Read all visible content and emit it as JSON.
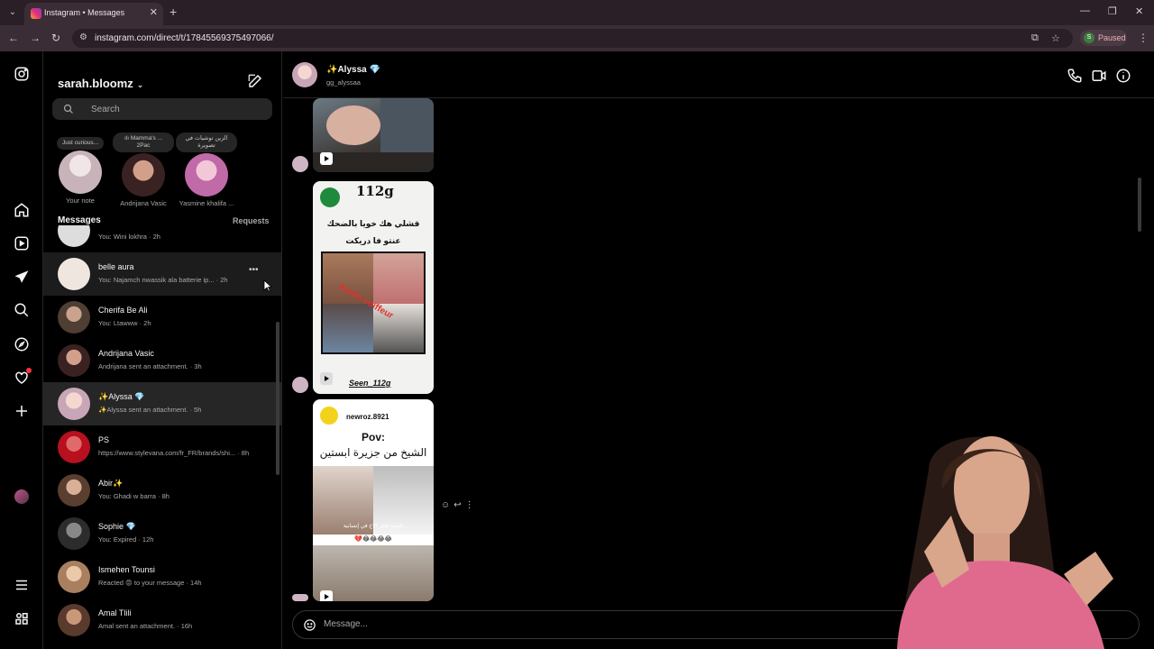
{
  "browser": {
    "tab_title": "Instagram • Messages",
    "url": "instagram.com/direct/t/17845569375497066/",
    "profile_badge": "S",
    "profile_status": "Paused"
  },
  "rail": {
    "icons": [
      "instagram-icon",
      "home-icon",
      "reels-icon",
      "messages-icon",
      "search-icon",
      "explore-icon",
      "heart-icon",
      "create-icon",
      "profile-avatar",
      "menu-icon",
      "apps-icon"
    ]
  },
  "inbox": {
    "username": "sarah.bloomz",
    "search_placeholder": "Search",
    "notes": [
      {
        "bubble": "Just curious...",
        "name": "Your note",
        "color": "#d9c2c8"
      },
      {
        "bubble": "ılı Mamma's ... 2Pac",
        "name": "Andrijana Vasic",
        "color": "#5a3a3a"
      },
      {
        "bubble": "الزين توشيات في تصويرة",
        "name": "Yasmine khalifa ...",
        "color": "#d27fb5"
      }
    ],
    "section_title": "Messages",
    "requests_label": "Requests",
    "conversations": [
      {
        "name": "",
        "sub": "You: Wini lokhra · 2h",
        "color": "#ddd"
      },
      {
        "name": "belle aura",
        "sub": "You: Najamch nwassik ala batterie ip... · 2h",
        "color": "#efe6e0"
      },
      {
        "name": "Cherifa Be Ali",
        "sub": "You: Ltawww · 2h",
        "color": "#6a5a50"
      },
      {
        "name": "Andrijana Vasic",
        "sub": "Andrijana sent an attachment. · 3h",
        "color": "#4b3432"
      },
      {
        "name": "✨Alyssa 💎",
        "sub": "✨Alyssa sent an attachment. · 5h",
        "color": "#c8a6b8"
      },
      {
        "name": "PS",
        "sub": "https://www.stylevana.com/fr_FR/brands/shi... · 8h",
        "color": "#c21d2b"
      },
      {
        "name": "Abir✨",
        "sub": "You: Ghadi w barra · 8h",
        "color": "#7d5a48"
      },
      {
        "name": "Sophie 💎",
        "sub": "You: Expired · 12h",
        "color": "#3c3c3c"
      },
      {
        "name": "Ismehen Tounsi",
        "sub": "Reacted 😡 to your message · 14h",
        "color": "#cfa58a"
      },
      {
        "name": "Amal Tlili",
        "sub": "Amal sent an attachment. · 16h",
        "color": "#6d4b3c"
      }
    ]
  },
  "chat": {
    "name": "✨Alyssa 💎",
    "handle": "gg_alyssaa",
    "composer_placeholder": "Message...",
    "reel2": {
      "title_ar": "قشلي هك خويا بالضحك عنتو فا دريكت",
      "watermark": "Karim coiffeur",
      "caption": "Seen_112g",
      "logo": "112g"
    },
    "reel3": {
      "account": "newroz.8921",
      "pov": "Pov:",
      "text_ar": "الشيخ من جزيرة ابستين",
      "sub_ar": "الشيخ فطر الاخ في إنسانية",
      "emojis": "💔😂😂😂😂"
    }
  }
}
